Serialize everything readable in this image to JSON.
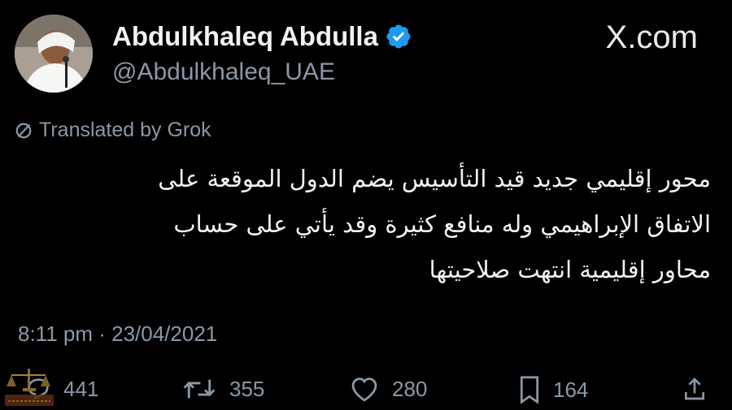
{
  "author": {
    "name": "Abdulkhaleq Abdulla",
    "handle": "@Abdulkhaleq_UAE",
    "verified": true
  },
  "site": {
    "brand": "X.com"
  },
  "translation_note": "Translated by Grok",
  "tweet": {
    "lines": [
      "محور إقليمي جديد قيد التأسيس يضم الدول الموقعة على",
      "الاتفاق الإبراهيمي وله منافع كثيرة وقد يأتي على حساب",
      "محاور إقليمية انتهت صلاحيتها"
    ],
    "timestamp": "8:11 pm · 23/04/2021"
  },
  "actions": {
    "replies": "441",
    "reposts": "355",
    "likes": "280",
    "bookmarks": "164"
  },
  "watermark_text": "البندريه العربية للدراسات الشؤون",
  "colors": {
    "background": "#000000",
    "text": "#e7e9ea",
    "muted": "#8b98a5",
    "verified": "#1d9bf0"
  }
}
